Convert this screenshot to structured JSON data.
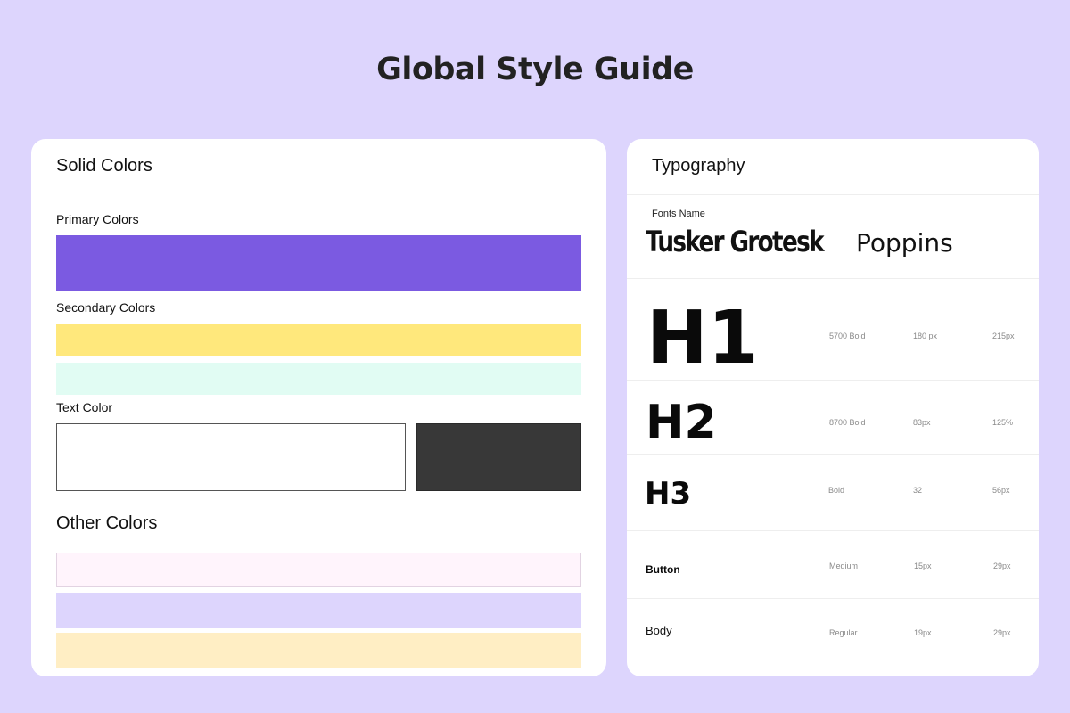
{
  "page": {
    "title": "Global Style Guide",
    "background": "#ddd5fd"
  },
  "solid_colors": {
    "title": "Solid Colors",
    "primary": {
      "label": "Primary Colors",
      "swatches": [
        "#7b5ae1"
      ]
    },
    "secondary": {
      "label": "Secondary Colors",
      "swatches": [
        "#ffe87c",
        "#e1fcf3"
      ]
    },
    "text": {
      "label": "Text Color",
      "swatches": [
        "#ffffff",
        "#383838"
      ]
    }
  },
  "other_colors": {
    "title": "Other Colors",
    "swatches": [
      "#fff4fc",
      "#ddd5fd",
      "#ffeec4"
    ]
  },
  "typography": {
    "title": "Typography",
    "fonts_label": "Fonts Name",
    "fonts": [
      "Tusker Grotesk",
      "Poppins"
    ],
    "styles": [
      {
        "sample": "H1",
        "weight": "5700 Bold",
        "size": "180 px",
        "line_height": "215px"
      },
      {
        "sample": "H2",
        "weight": "8700 Bold",
        "size": "83px",
        "line_height": "125%"
      },
      {
        "sample": "H3",
        "weight": "Bold",
        "size": "32",
        "line_height": "56px"
      },
      {
        "sample": "Button",
        "weight": "Medium",
        "size": "15px",
        "line_height": "29px"
      },
      {
        "sample": "Body",
        "weight": "Regular",
        "size": "19px",
        "line_height": "29px"
      }
    ]
  }
}
